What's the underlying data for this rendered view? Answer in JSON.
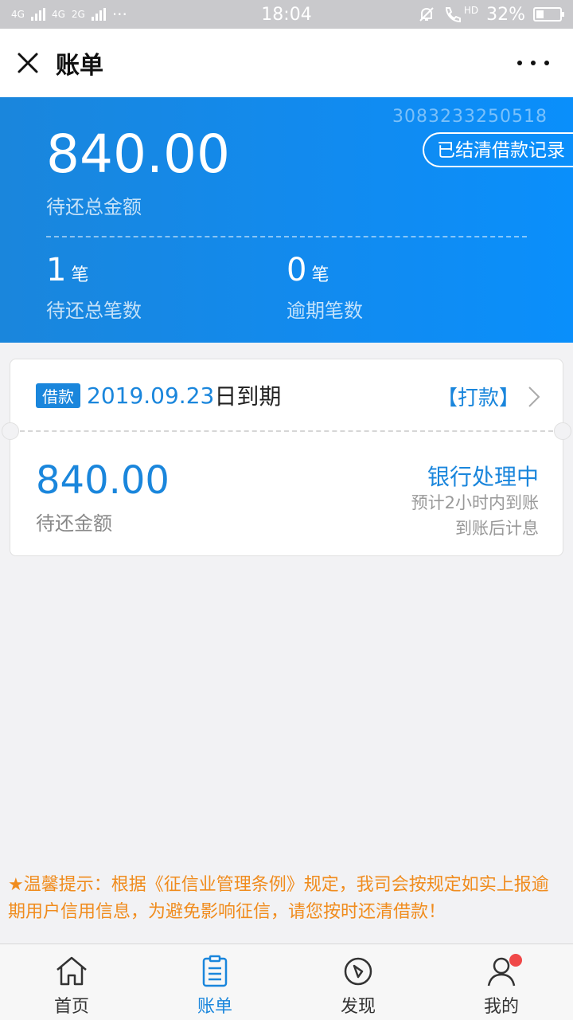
{
  "status_bar": {
    "network_1": "4G",
    "network_2": "4G",
    "network_3": "2G",
    "dots": "···",
    "time": "18:04",
    "hd": "HD",
    "battery_text": "32%",
    "battery_level": 0.32
  },
  "header": {
    "title": "账单"
  },
  "summary": {
    "account_number": "3083233250518",
    "history_button": "已结清借款记录",
    "total_amount": "840.00",
    "total_label": "待还总金额",
    "count_value": "1",
    "count_unit": "笔",
    "count_label": "待还总笔数",
    "overdue_value": "0",
    "overdue_unit": "笔",
    "overdue_label": "逾期笔数"
  },
  "loan_card": {
    "tag": "借款",
    "due_date": "2019.09.23",
    "due_suffix": "日到期",
    "pay_link": "【打款】",
    "amount": "840.00",
    "amount_label": "待还金额",
    "status": "银行处理中",
    "eta": "预计2小时内到账",
    "note": "到账后计息"
  },
  "tip": {
    "text": "★温馨提示：根据《征信业管理条例》规定，我司会按规定如实上报逾期用户信用信息，为避免影响征信，请您按时还清借款！"
  },
  "tabbar": {
    "items": [
      {
        "label": "首页",
        "icon": "home-icon"
      },
      {
        "label": "账单",
        "icon": "bill-icon"
      },
      {
        "label": "发现",
        "icon": "compass-icon"
      },
      {
        "label": "我的",
        "icon": "user-icon"
      }
    ],
    "active_index": 1
  },
  "colors": {
    "accent": "#1a86dc",
    "tip": "#f08c1e",
    "badge": "#f04848"
  }
}
